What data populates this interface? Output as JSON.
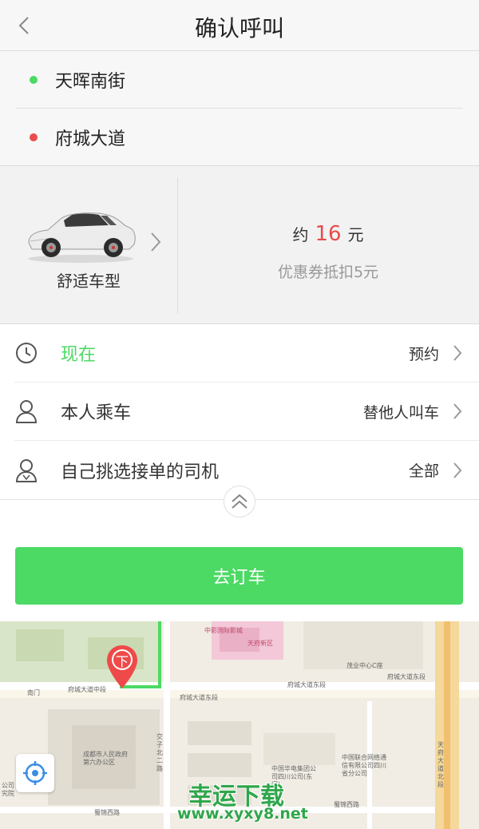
{
  "header": {
    "title": "确认呼叫",
    "back_icon": "chevron-left-icon"
  },
  "route": {
    "start": {
      "label": "天晖南街",
      "dot_color": "#4cd964"
    },
    "end": {
      "label": "府城大道",
      "dot_color": "#e84c4c"
    }
  },
  "car": {
    "type_label": "舒适车型"
  },
  "price": {
    "prefix": "约",
    "amount": "16",
    "unit": "元",
    "coupon": "优惠券抵扣5元",
    "amount_color": "#e84c4c"
  },
  "options": [
    {
      "icon": "clock-icon",
      "label": "现在",
      "right": "预约"
    },
    {
      "icon": "person-icon",
      "label": "本人乘车",
      "right": "替他人叫车"
    },
    {
      "icon": "driver-icon",
      "label": "自己挑选接单的司机",
      "right": "全部"
    }
  ],
  "order_button": {
    "label": "去订车",
    "color": "#4cd964"
  },
  "map": {
    "pin_label": "下",
    "labels": [
      "中影国际影城",
      "天府新区",
      "茂业中心C座",
      "府城大道东段",
      "府城大道中段",
      "南门",
      "成都市人民政府第六办公区",
      "中国华电集团公司四川公司(东门)",
      "中国联合网络通信有限公司四川省分公司",
      "交子北二路",
      "蜀锦西路",
      "天府大道北段",
      "公司",
      "究院"
    ]
  },
  "watermark": {
    "title": "幸运下载",
    "url": "www.xyxy8.net"
  }
}
